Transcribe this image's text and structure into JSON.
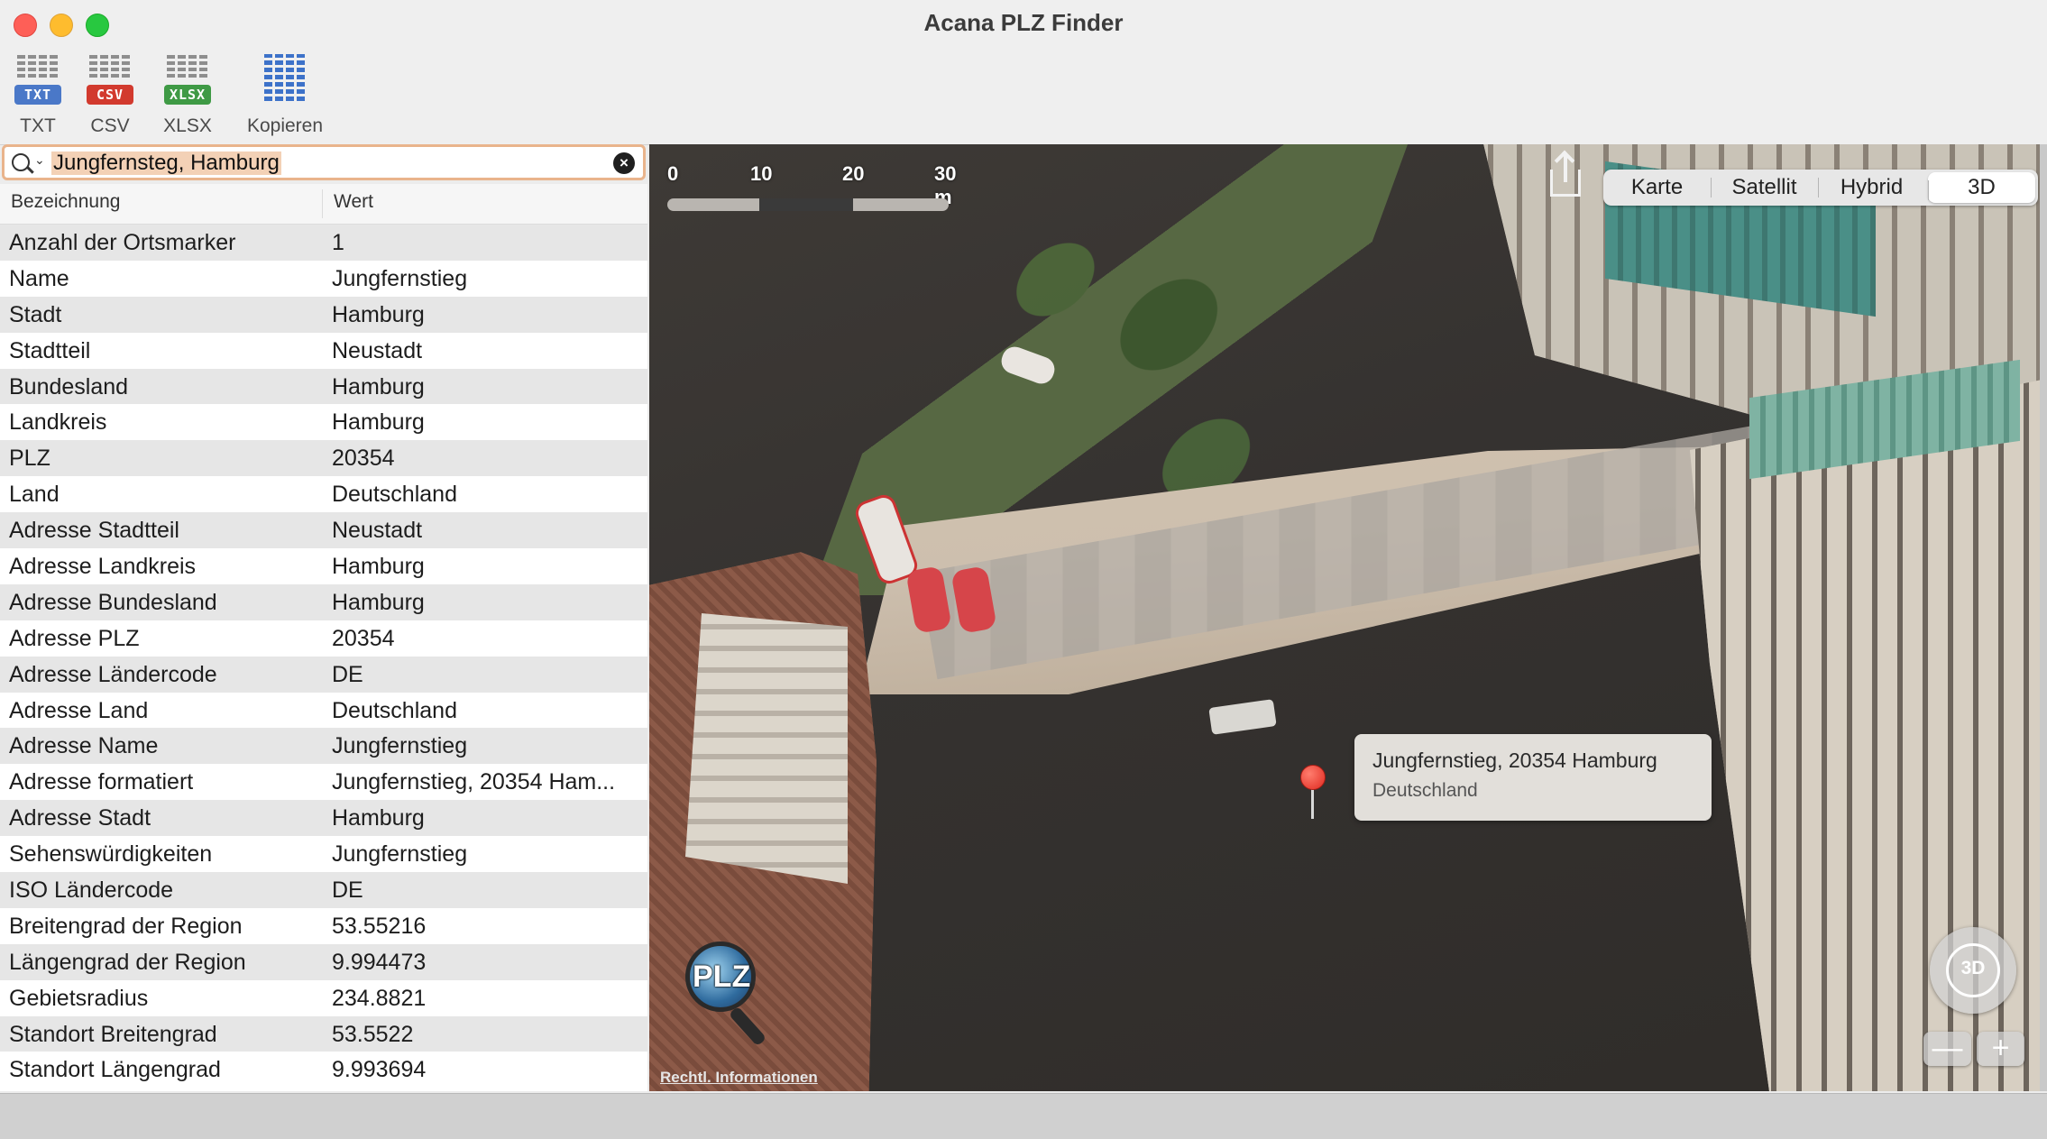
{
  "window": {
    "title": "Acana PLZ Finder"
  },
  "toolbar": {
    "buttons": [
      {
        "label": "TXT",
        "tag": "TXT",
        "color": "#4a78c8"
      },
      {
        "label": "CSV",
        "tag": "CSV",
        "color": "#d23a2e"
      },
      {
        "label": "XLSX",
        "tag": "XLSX",
        "color": "#3f9a45"
      },
      {
        "label": "Kopieren"
      }
    ]
  },
  "search": {
    "value": "Jungfernsteg, Hamburg"
  },
  "table": {
    "headers": [
      "Bezeichnung",
      "Wert"
    ],
    "rows": [
      {
        "key": "Anzahl der Ortsmarker",
        "value": "1"
      },
      {
        "key": "Name",
        "value": "Jungfernstieg"
      },
      {
        "key": "Stadt",
        "value": "Hamburg"
      },
      {
        "key": "Stadtteil",
        "value": "Neustadt"
      },
      {
        "key": "Bundesland",
        "value": "Hamburg"
      },
      {
        "key": "Landkreis",
        "value": "Hamburg"
      },
      {
        "key": "PLZ",
        "value": "20354"
      },
      {
        "key": "Land",
        "value": "Deutschland"
      },
      {
        "key": "Adresse Stadtteil",
        "value": "Neustadt"
      },
      {
        "key": "Adresse Landkreis",
        "value": "Hamburg"
      },
      {
        "key": "Adresse Bundesland",
        "value": "Hamburg"
      },
      {
        "key": "Adresse PLZ",
        "value": "20354"
      },
      {
        "key": "Adresse Ländercode",
        "value": "DE"
      },
      {
        "key": "Adresse Land",
        "value": "Deutschland"
      },
      {
        "key": "Adresse Name",
        "value": "Jungfernstieg"
      },
      {
        "key": "Adresse formatiert",
        "value": "Jungfernstieg, 20354 Ham..."
      },
      {
        "key": "Adresse Stadt",
        "value": "Hamburg"
      },
      {
        "key": "Sehenswürdigkeiten",
        "value": "Jungfernstieg"
      },
      {
        "key": "ISO Ländercode",
        "value": "DE"
      },
      {
        "key": "Breitengrad der Region",
        "value": "53.55216"
      },
      {
        "key": "Längengrad der Region",
        "value": "9.994473"
      },
      {
        "key": "Gebietsradius",
        "value": "234.8821"
      },
      {
        "key": "Standort Breitengrad",
        "value": "53.5522"
      },
      {
        "key": "Standort Längengrad",
        "value": "9.993694"
      }
    ]
  },
  "map": {
    "scale_labels": [
      "0",
      "10",
      "20",
      "30 m"
    ],
    "map_types": [
      "Karte",
      "Satellit",
      "Hybrid",
      "3D"
    ],
    "selected_map_type": "3D",
    "callout": {
      "line1": "Jungfernstieg, 20354 Hamburg",
      "line2": "Deutschland"
    },
    "logo_text": "PLZ",
    "legal_link": "Rechtl. Informationen",
    "compass_label": "3D",
    "zoom_out": "—",
    "zoom_in": "+"
  }
}
